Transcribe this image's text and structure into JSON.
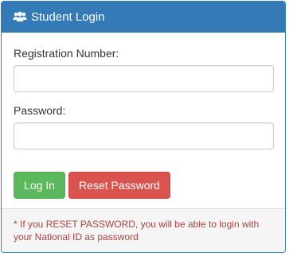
{
  "panel": {
    "title": "Student Login",
    "icon": "users-icon"
  },
  "form": {
    "registration_label": "Registration Number:",
    "registration_value": "",
    "password_label": "Password:",
    "password_value": ""
  },
  "buttons": {
    "login_label": "Log In",
    "reset_label": "Reset Password"
  },
  "footer": {
    "note_line1": "* If you RESET PASSWORD, you will be able to login with",
    "note_line2": "your National ID as password"
  },
  "colors": {
    "primary": "#337ab7",
    "success": "#5cb85c",
    "danger": "#d9534f",
    "note_text": "#a94442"
  }
}
